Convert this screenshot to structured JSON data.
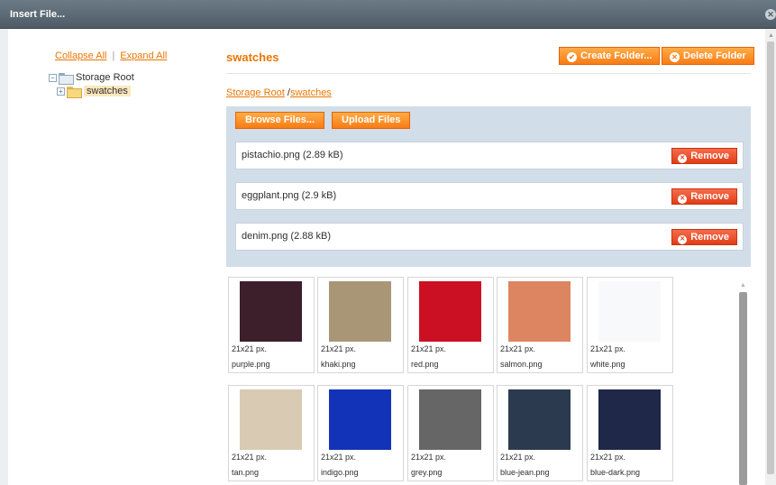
{
  "window": {
    "title": "Insert File...",
    "close_glyph": "✕"
  },
  "tree": {
    "collapse_all": "Collapse All",
    "separator": "|",
    "expand_all": "Expand All",
    "root": {
      "toggle": "−",
      "label": "Storage Root"
    },
    "child": {
      "toggle": "+",
      "label": "swatches"
    }
  },
  "header": {
    "folder_title": "swatches",
    "create_folder": "Create Folder...",
    "delete_folder": "Delete Folder"
  },
  "breadcrumb": {
    "root": "Storage Root",
    "sep": " /",
    "current": "swatches"
  },
  "uploader": {
    "browse_label": "Browse Files...",
    "upload_label": "Upload Files",
    "remove_label": "Remove",
    "files": [
      {
        "name": "pistachio.png (2.89 kB)"
      },
      {
        "name": "eggplant.png (2.9 kB)"
      },
      {
        "name": "denim.png (2.88 kB)"
      }
    ]
  },
  "gallery": [
    {
      "size": "21x21 px.",
      "file": "purple.png",
      "color": "#3c1f2b"
    },
    {
      "size": "21x21 px.",
      "file": "khaki.png",
      "color": "#a99677"
    },
    {
      "size": "21x21 px.",
      "file": "red.png",
      "color": "#cc1023"
    },
    {
      "size": "21x21 px.",
      "file": "salmon.png",
      "color": "#dd8560"
    },
    {
      "size": "21x21 px.",
      "file": "white.png",
      "color": "#f8f9fb"
    },
    {
      "size": "21x21 px.",
      "file": "tan.png",
      "color": "#d8cab3"
    },
    {
      "size": "21x21 px.",
      "file": "indigo.png",
      "color": "#1233b8"
    },
    {
      "size": "21x21 px.",
      "file": "grey.png",
      "color": "#666666"
    },
    {
      "size": "21x21 px.",
      "file": "blue-jean.png",
      "color": "#2b3a4f"
    },
    {
      "size": "21x21 px.",
      "file": "blue-dark.png",
      "color": "#1f2849"
    }
  ],
  "colors": {
    "accent": "#ea7601",
    "remove": "#e03e16",
    "uploader_bg": "#d1dde8"
  }
}
